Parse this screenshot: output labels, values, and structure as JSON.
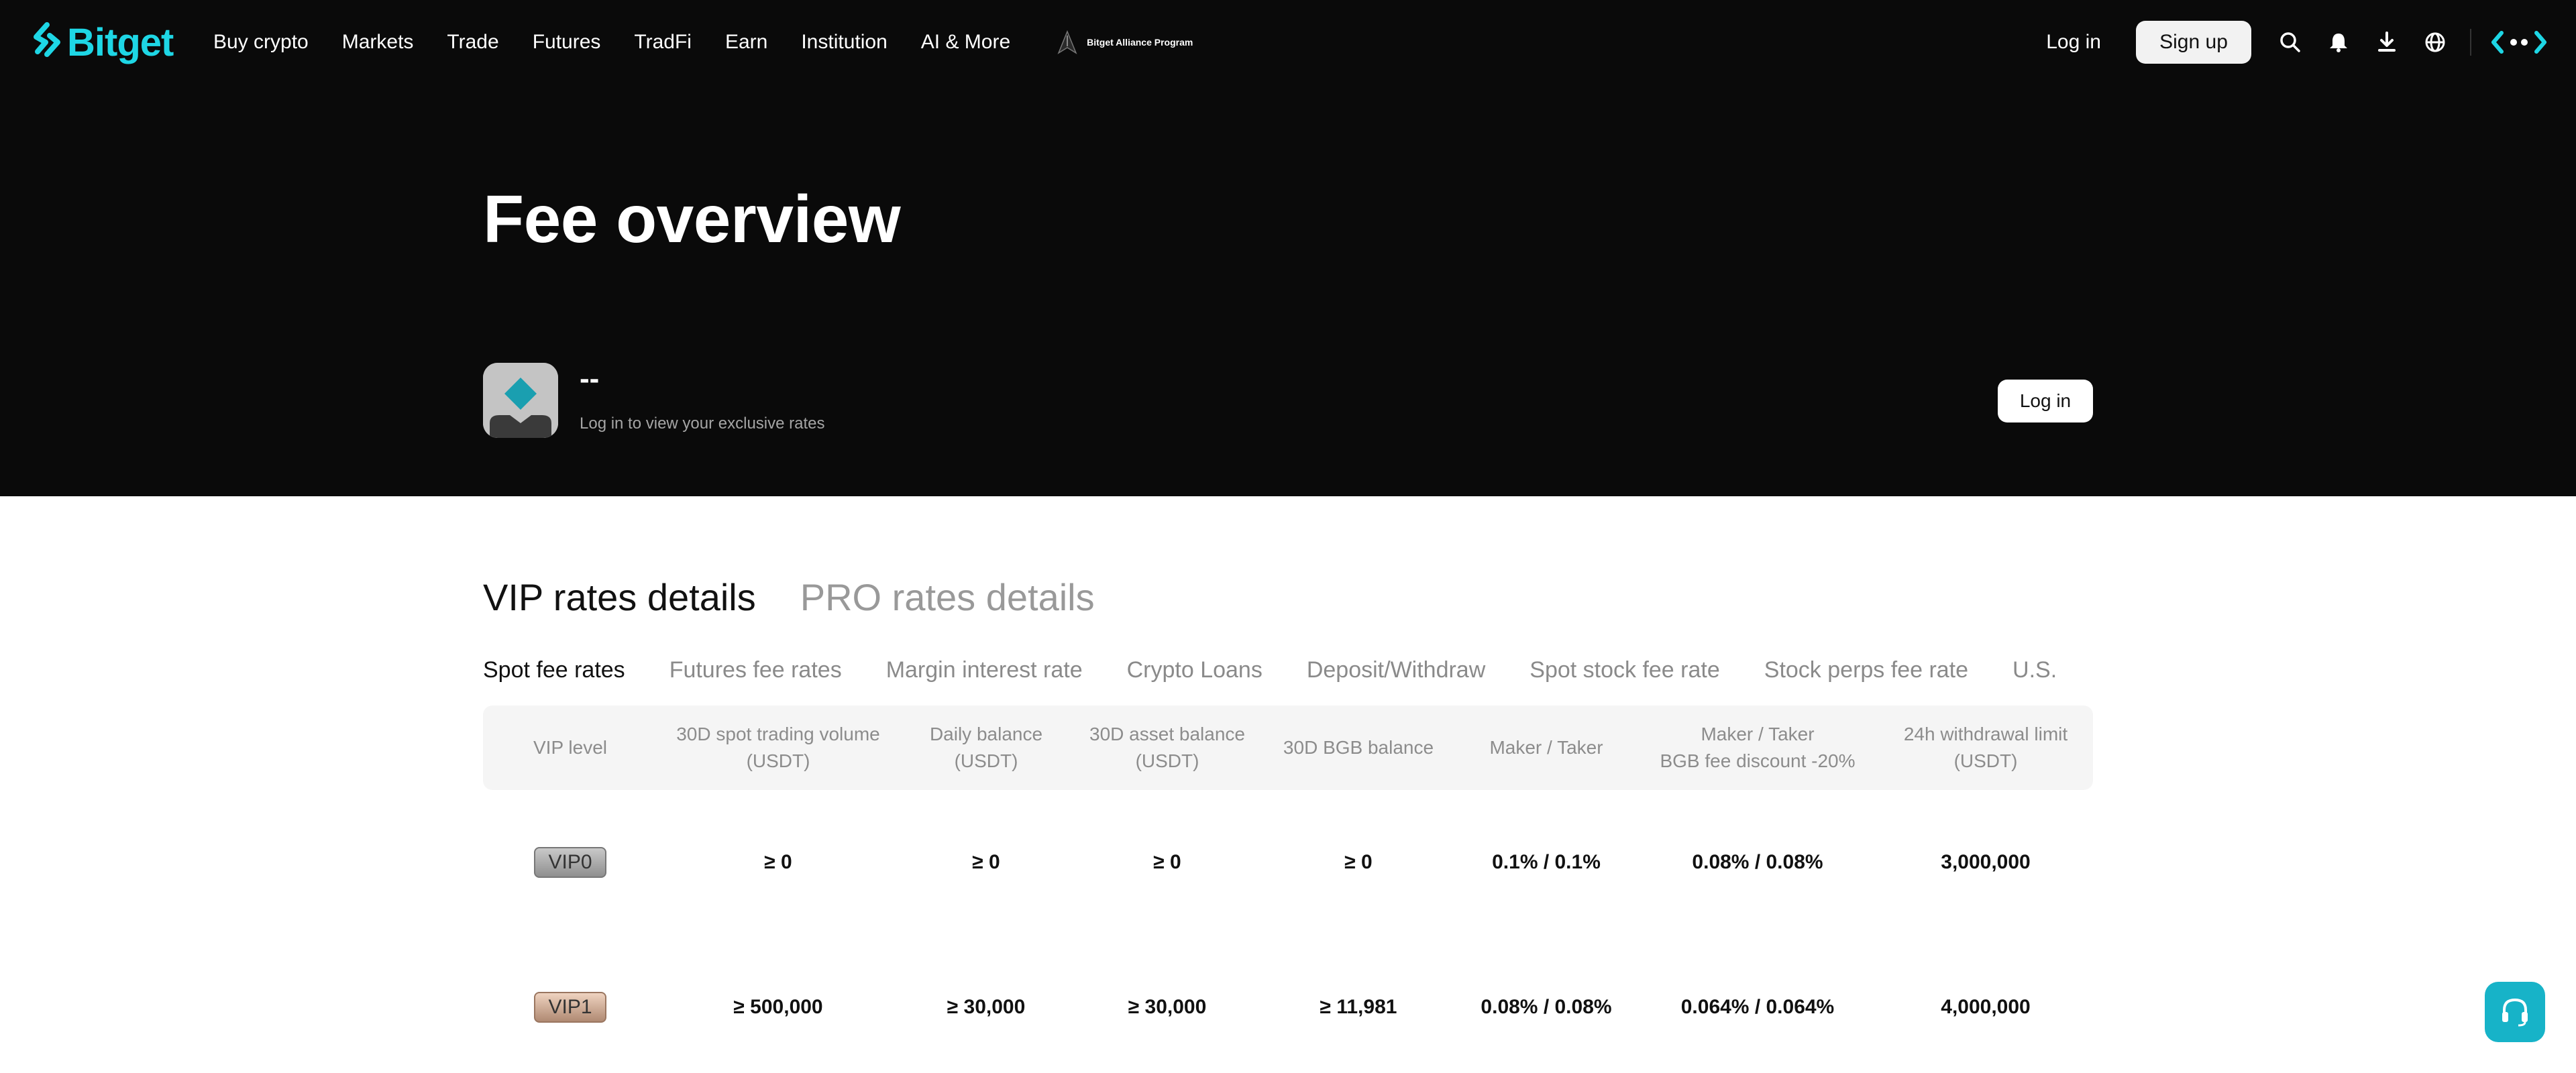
{
  "brand": {
    "name": "Bitget",
    "accent": "#1ed6e5"
  },
  "nav": {
    "links": [
      "Buy crypto",
      "Markets",
      "Trade",
      "Futures",
      "TradFi",
      "Earn",
      "Institution",
      "AI & More"
    ],
    "alliance": "Bitget Alliance Program",
    "login": "Log in",
    "signup": "Sign up",
    "icons": [
      "search-icon",
      "bell-icon",
      "download-icon",
      "globe-icon",
      "brand-mark-icon"
    ]
  },
  "hero": {
    "title": "Fee overview",
    "user_name": "--",
    "user_sub": "Log in to view your exclusive rates",
    "login_button": "Log in"
  },
  "rate_tabs": [
    "VIP rates details",
    "PRO rates details"
  ],
  "sub_tabs": [
    "Spot fee rates",
    "Futures fee rates",
    "Margin interest rate",
    "Crypto Loans",
    "Deposit/Withdraw",
    "Spot stock fee rate",
    "Stock perps fee rate",
    "U.S."
  ],
  "table": {
    "headers": [
      [
        "VIP level"
      ],
      [
        "30D spot trading volume",
        "(USDT)"
      ],
      [
        "Daily balance",
        "(USDT)"
      ],
      [
        "30D asset balance",
        "(USDT)"
      ],
      [
        "30D BGB balance"
      ],
      [
        "Maker / Taker"
      ],
      [
        "Maker / Taker",
        "BGB fee discount -20%"
      ],
      [
        "24h withdrawal limit",
        "(USDT)"
      ]
    ],
    "rows": [
      {
        "level": "VIP0",
        "volume": "≥ 0",
        "daily": "≥ 0",
        "asset": "≥ 0",
        "bgb": "≥ 0",
        "maker_taker": "0.1% / 0.1%",
        "discount": "0.08% / 0.08%",
        "limit": "3,000,000"
      },
      {
        "level": "VIP1",
        "volume": "≥ 500,000",
        "daily": "≥ 30,000",
        "asset": "≥ 30,000",
        "bgb": "≥ 11,981",
        "maker_taker": "0.08% / 0.08%",
        "discount": "0.064% / 0.064%",
        "limit": "4,000,000"
      }
    ]
  }
}
